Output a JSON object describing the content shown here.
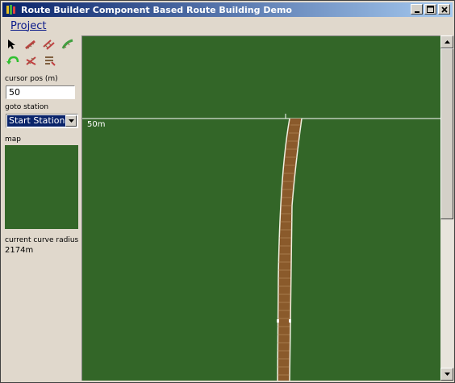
{
  "window": {
    "title": "Route Builder Component Based Route Building Demo"
  },
  "menu": {
    "items": [
      {
        "label": "Project"
      }
    ]
  },
  "toolbar": {
    "tools": [
      {
        "icon": "arrow-pointer-icon"
      },
      {
        "icon": "straight-track-icon"
      },
      {
        "icon": "double-track-icon"
      },
      {
        "icon": "curved-track-icon"
      },
      {
        "icon": "undo-icon"
      },
      {
        "icon": "track-junction-icon"
      },
      {
        "icon": "track-end-icon"
      }
    ]
  },
  "sidebar": {
    "cursor_pos_label": "cursor pos (m)",
    "cursor_pos_value": "50",
    "goto_station_label": "goto station",
    "goto_station_value": "Start Station",
    "map_label": "map",
    "curve_radius_label": "current curve radius",
    "curve_radius_value": "2174m"
  },
  "viewport": {
    "distance_marker": "50m"
  },
  "colors": {
    "grass": "#336628",
    "track": "#8a5a2b",
    "rail": "#f0f0e0",
    "title_gradient_start": "#0a246a",
    "title_gradient_end": "#a6caf0"
  }
}
